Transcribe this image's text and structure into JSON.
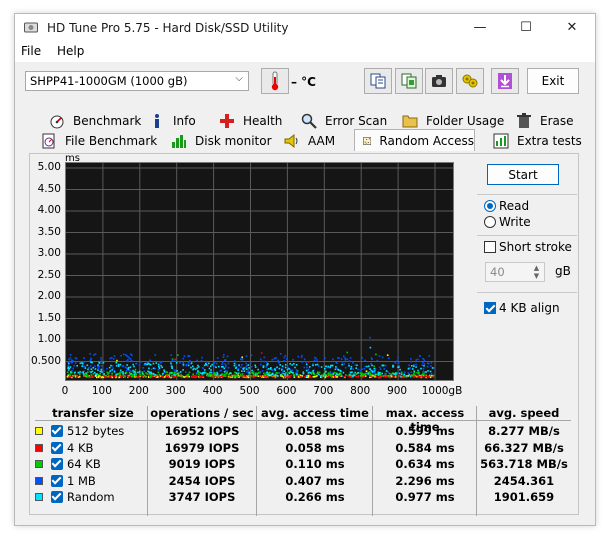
{
  "window": {
    "title": "HD Tune Pro 5.75 - Hard Disk/SSD Utility",
    "controls": {
      "minimize": "—",
      "maximize": "☐",
      "close": "✕"
    }
  },
  "menu": {
    "file": "File",
    "help": "Help"
  },
  "toolbar": {
    "drive": "SHPP41-1000GM (1000 gB)",
    "temperature": "– °C",
    "exit_label": "Exit",
    "icons": [
      "copy-info-icon",
      "copy-screen-icon",
      "camera-icon",
      "options-icon",
      "download-icon"
    ]
  },
  "tabs": {
    "row1": [
      "Benchmark",
      "Info",
      "Health",
      "Error Scan",
      "Folder Usage",
      "Erase"
    ],
    "row2": [
      "File Benchmark",
      "Disk monitor",
      "AAM",
      "Random Access",
      "Extra tests"
    ],
    "active": "Random Access"
  },
  "chart": {
    "y_unit": "ms",
    "y_ticks": [
      "5.00",
      "4.50",
      "4.00",
      "3.50",
      "3.00",
      "2.50",
      "2.00",
      "1.50",
      "1.00",
      "0.500"
    ],
    "x_ticks": [
      "0",
      "100",
      "200",
      "300",
      "400",
      "500",
      "600",
      "700",
      "800",
      "900",
      "1000gB"
    ]
  },
  "controls": {
    "start_label": "Start",
    "read_label": "Read",
    "write_label": "Write",
    "mode": "read",
    "short_stroke_label": "Short stroke",
    "short_stroke_checked": false,
    "stroke_value": "40",
    "stroke_unit": "gB",
    "align_label": "4 KB align",
    "align_checked": true
  },
  "results": {
    "headers": [
      "transfer size",
      "operations / sec",
      "avg. access time",
      "max. access time",
      "avg. speed"
    ],
    "rows": [
      {
        "name": "512 bytes",
        "color": "#ffff00",
        "ops": "16952 IOPS",
        "avg": "0.058 ms",
        "max": "0.599 ms",
        "speed": "8.277 MB/s"
      },
      {
        "name": "4 KB",
        "color": "#ff0000",
        "ops": "16979 IOPS",
        "avg": "0.058 ms",
        "max": "0.584 ms",
        "speed": "66.327 MB/s"
      },
      {
        "name": "64 KB",
        "color": "#00cc00",
        "ops": "9019 IOPS",
        "avg": "0.110 ms",
        "max": "0.634 ms",
        "speed": "563.718 MB/s"
      },
      {
        "name": "1 MB",
        "color": "#0050ff",
        "ops": "2454 IOPS",
        "avg": "0.407 ms",
        "max": "2.296 ms",
        "speed": "2454.361"
      },
      {
        "name": "Random",
        "color": "#00e5ff",
        "ops": "3747 IOPS",
        "avg": "0.266 ms",
        "max": "0.977 ms",
        "speed": "1901.659"
      }
    ]
  }
}
